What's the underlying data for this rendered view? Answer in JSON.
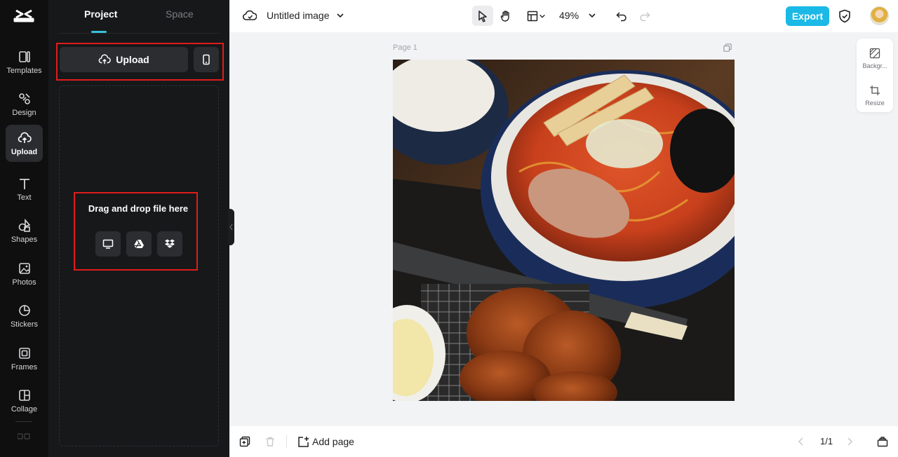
{
  "rail": {
    "items": [
      {
        "label": "Templates",
        "icon": "templates-icon"
      },
      {
        "label": "Design",
        "icon": "design-icon"
      },
      {
        "label": "Upload",
        "icon": "upload-cloud-icon",
        "active": true
      },
      {
        "label": "Text",
        "icon": "text-icon"
      },
      {
        "label": "Shapes",
        "icon": "shapes-icon"
      },
      {
        "label": "Photos",
        "icon": "photos-icon"
      },
      {
        "label": "Stickers",
        "icon": "stickers-icon"
      },
      {
        "label": "Frames",
        "icon": "frames-icon"
      },
      {
        "label": "Collage",
        "icon": "collage-icon"
      }
    ]
  },
  "panel": {
    "tabs": [
      {
        "label": "Project",
        "active": true
      },
      {
        "label": "Space"
      }
    ],
    "upload_label": "Upload",
    "drop_text": "Drag and drop file here",
    "sources": [
      "computer-icon",
      "google-drive-icon",
      "dropbox-icon"
    ]
  },
  "topbar": {
    "title": "Untitled image",
    "zoom": "49%",
    "export_label": "Export"
  },
  "canvas": {
    "page_label": "Page 1",
    "image_subject": "ramen-with-fried-chicken-photo"
  },
  "right_panel": {
    "items": [
      {
        "label": "Backgr..."
      },
      {
        "label": "Resize"
      }
    ]
  },
  "bottombar": {
    "add_page": "Add page",
    "page_count": "1/1"
  },
  "colors": {
    "accent": "#1bb9e6",
    "highlight_box": "#e01c1c",
    "rail_bg": "#0f0f10",
    "panel_bg": "#17181a"
  }
}
